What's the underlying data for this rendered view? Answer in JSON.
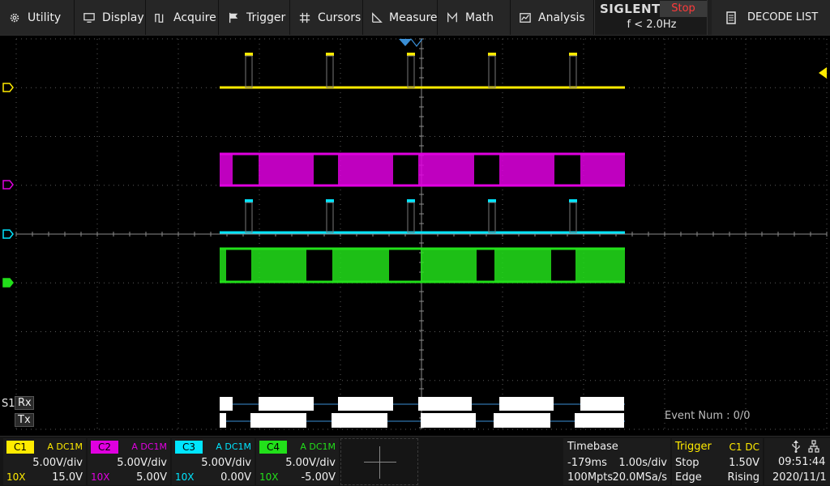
{
  "menu": {
    "utility": "Utility",
    "display": "Display",
    "acquire": "Acquire",
    "trigger": "Trigger",
    "cursors": "Cursors",
    "measure": "Measure",
    "math": "Math",
    "analysis": "Analysis",
    "decode_list": "DECODE LIST"
  },
  "brand": {
    "name": "SIGLENT",
    "run_state": "Stop",
    "trigger_frequency": "f < 2.0Hz"
  },
  "bus": {
    "label": "S1",
    "rx_label": "Rx",
    "tx_label": "Tx",
    "event_num": "Event Num : 0/0"
  },
  "channels": [
    {
      "name": "C1",
      "coupling": "A DC1M",
      "scale": "5.00V/div",
      "probe": "10X",
      "offset": "15.0V",
      "color": "#ffeb00"
    },
    {
      "name": "C2",
      "coupling": "A DC1M",
      "scale": "5.00V/div",
      "probe": "10X",
      "offset": "5.00V",
      "color": "#e000e0"
    },
    {
      "name": "C3",
      "coupling": "A DC1M",
      "scale": "5.00V/div",
      "probe": "10X",
      "offset": "0.00V",
      "color": "#00e5ff"
    },
    {
      "name": "C4",
      "coupling": "A DC1M",
      "scale": "5.00V/div",
      "probe": "10X",
      "offset": "-5.00V",
      "color": "#22e01a"
    }
  ],
  "timebase": {
    "title": "Timebase",
    "delay": "-179ms",
    "scale": "1.00s/div",
    "memory_depth": "100Mpts",
    "sample_rate": "20.0MSa/s"
  },
  "trigger": {
    "title": "Trigger",
    "source": "C1 DC",
    "state": "Stop",
    "level": "1.50V",
    "type": "Edge",
    "slope": "Rising"
  },
  "clock": {
    "time": "09:51:44",
    "date": "2020/11/1"
  },
  "icons": [
    "gear-icon",
    "monitor-icon",
    "acquire-icon",
    "flag-icon",
    "cursors-icon",
    "measure-icon",
    "math-icon",
    "analysis-icon",
    "list-icon",
    "usb-icon"
  ],
  "colors": {
    "grid": "#5a5a5a",
    "accent_trigger": "#ffeb00",
    "stop": "#ff3a3a",
    "bus_line": "#3a8fd6"
  }
}
